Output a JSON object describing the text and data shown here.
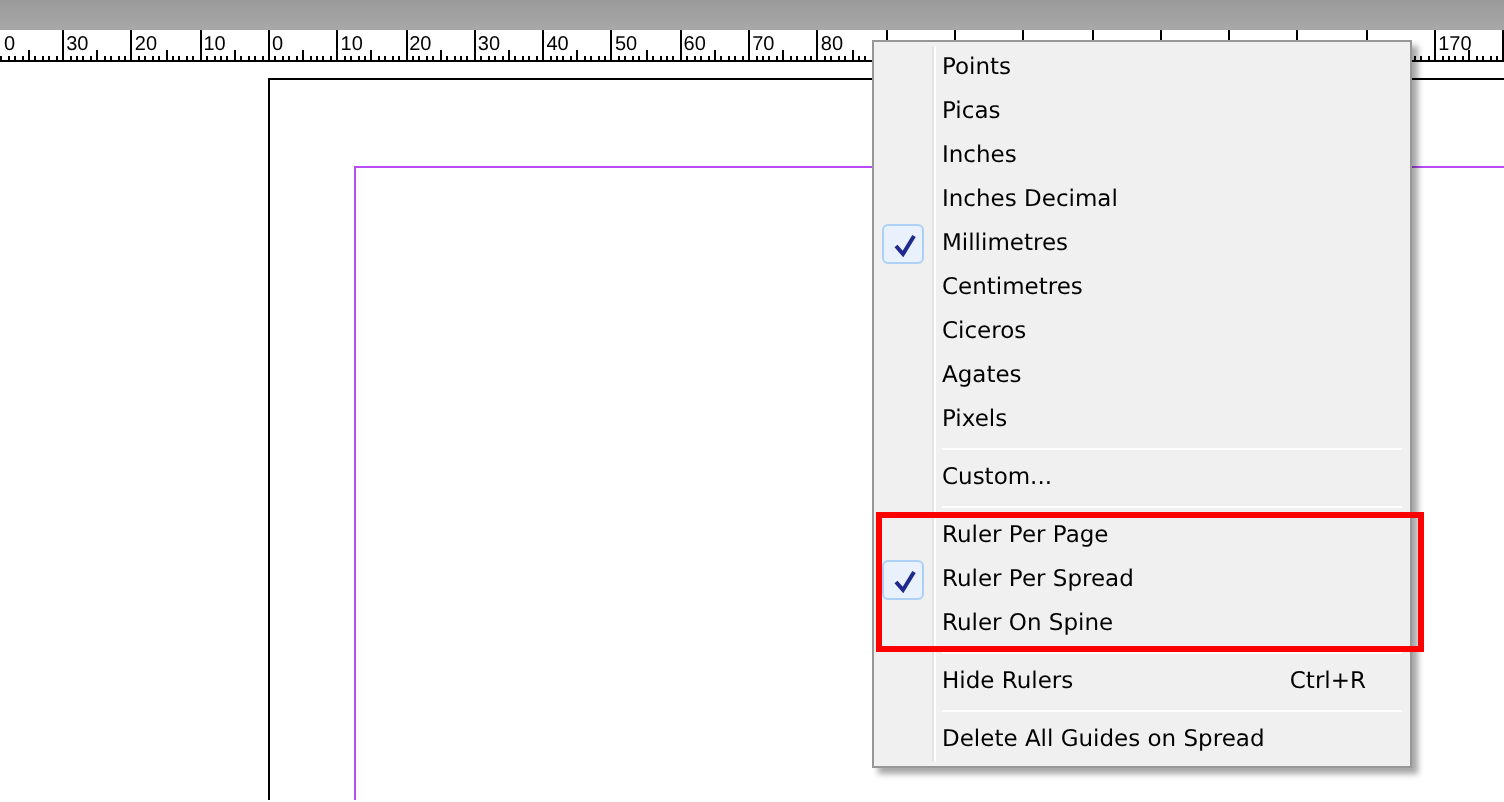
{
  "ruler": {
    "left_labels": [
      "0",
      "30",
      "20",
      "10",
      "0",
      "10",
      "20",
      "30",
      "40",
      "50",
      "60",
      "70",
      "80"
    ],
    "right_labels": [
      "170"
    ]
  },
  "menu": {
    "groups": [
      {
        "items": [
          {
            "label": "Points",
            "checked": false
          },
          {
            "label": "Picas",
            "checked": false
          },
          {
            "label": "Inches",
            "checked": false
          },
          {
            "label": "Inches Decimal",
            "checked": false
          },
          {
            "label": "Millimetres",
            "checked": true
          },
          {
            "label": "Centimetres",
            "checked": false
          },
          {
            "label": "Ciceros",
            "checked": false
          },
          {
            "label": "Agates",
            "checked": false
          },
          {
            "label": "Pixels",
            "checked": false
          }
        ]
      },
      {
        "items": [
          {
            "label": "Custom...",
            "checked": false
          }
        ]
      },
      {
        "annotated": true,
        "items": [
          {
            "label": "Ruler Per Page",
            "checked": false
          },
          {
            "label": "Ruler Per Spread",
            "checked": true
          },
          {
            "label": "Ruler On Spine",
            "checked": false
          }
        ]
      },
      {
        "items": [
          {
            "label": "Hide Rulers",
            "shortcut": "Ctrl+R",
            "checked": false
          }
        ]
      },
      {
        "items": [
          {
            "label": "Delete All Guides on Spread",
            "checked": false
          }
        ]
      }
    ]
  }
}
